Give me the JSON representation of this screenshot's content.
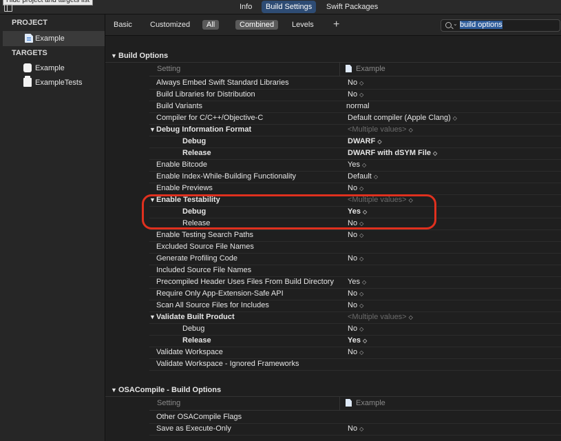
{
  "tooltip": "Hide project and targets list",
  "top_tabs": [
    "Info",
    "Build Settings",
    "Swift Packages"
  ],
  "sidebar": {
    "project_header": "PROJECT",
    "project_item": "Example",
    "targets_header": "TARGETS",
    "targets": [
      "Example",
      "ExampleTests"
    ]
  },
  "filter": {
    "tabs": [
      "Basic",
      "Customized",
      "All",
      "Combined",
      "Levels"
    ],
    "add": "+",
    "search_value": "build options"
  },
  "section1": {
    "title": "Build Options",
    "col_setting": "Setting",
    "col_target": "Example",
    "rows": [
      {
        "name": "Always Embed Swift Standard Libraries",
        "value": "No"
      },
      {
        "name": "Build Libraries for Distribution",
        "value": "No"
      },
      {
        "name": "Build Variants",
        "value": "normal"
      },
      {
        "name": "Compiler for C/C++/Objective-C",
        "value": "Default compiler (Apple Clang)"
      },
      {
        "name": "Debug Information Format",
        "value": "<Multiple values>"
      },
      {
        "name": "Debug",
        "value": "DWARF"
      },
      {
        "name": "Release",
        "value": "DWARF with dSYM File"
      },
      {
        "name": "Enable Bitcode",
        "value": "Yes"
      },
      {
        "name": "Enable Index-While-Building Functionality",
        "value": "Default"
      },
      {
        "name": "Enable Previews",
        "value": "No"
      },
      {
        "name": "Enable Testability",
        "value": "<Multiple values>"
      },
      {
        "name": "Debug",
        "value": "Yes"
      },
      {
        "name": "Release",
        "value": "No"
      },
      {
        "name": "Enable Testing Search Paths",
        "value": "No"
      },
      {
        "name": "Excluded Source File Names",
        "value": ""
      },
      {
        "name": "Generate Profiling Code",
        "value": "No"
      },
      {
        "name": "Included Source File Names",
        "value": ""
      },
      {
        "name": "Precompiled Header Uses Files From Build Directory",
        "value": "Yes"
      },
      {
        "name": "Require Only App-Extension-Safe API",
        "value": "No"
      },
      {
        "name": "Scan All Source Files for Includes",
        "value": "No"
      },
      {
        "name": "Validate Built Product",
        "value": "<Multiple values>"
      },
      {
        "name": "Debug",
        "value": "No"
      },
      {
        "name": "Release",
        "value": "Yes"
      },
      {
        "name": "Validate Workspace",
        "value": "No"
      },
      {
        "name": "Validate Workspace - Ignored Frameworks",
        "value": ""
      }
    ]
  },
  "section2": {
    "title": "OSACompile - Build Options",
    "col_setting": "Setting",
    "col_target": "Example",
    "rows": [
      {
        "name": "Other OSACompile Flags",
        "value": ""
      },
      {
        "name": "Save as Execute-Only",
        "value": "No"
      }
    ]
  }
}
